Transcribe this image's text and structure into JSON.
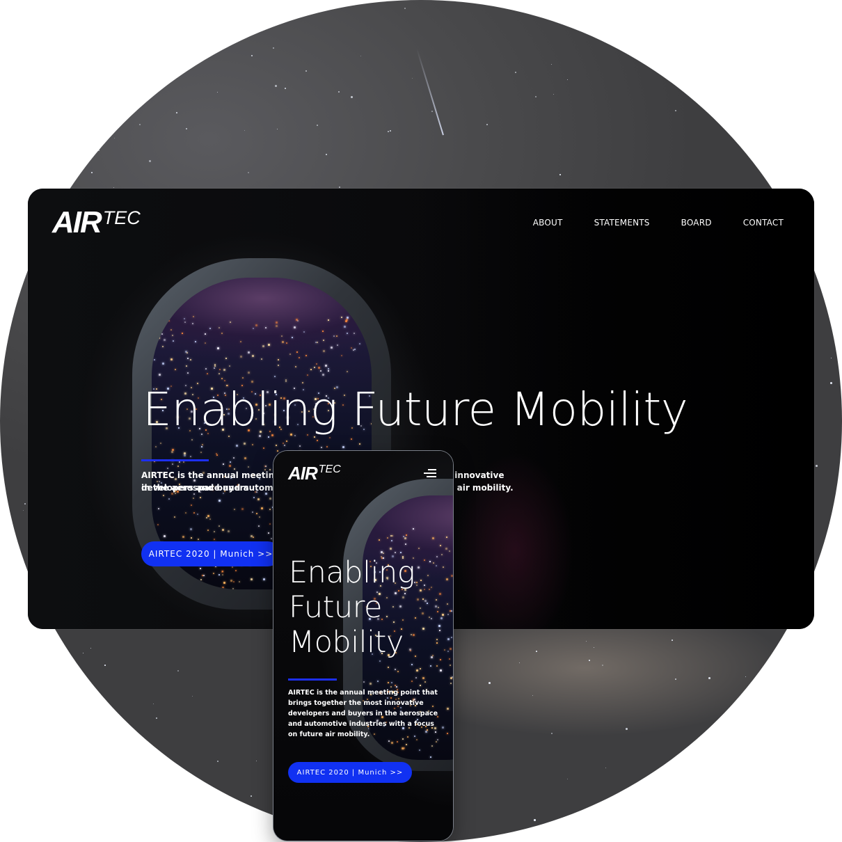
{
  "brand": {
    "logo_main": "AIR",
    "logo_sub": "TEC"
  },
  "nav": {
    "items": [
      "ABOUT",
      "STATEMENTS",
      "BOARD",
      "CONTACT"
    ]
  },
  "hero": {
    "title": "Enabling Future Mobility",
    "title_line1": "Enabling",
    "title_line2": "Future",
    "title_line3": "Mobility",
    "desc_desktop_line1": "AIRTEC is the annual meeting point that brings together the most innovative developers and buyers",
    "desc_desktop_line2": "in the aerospace and automotive industries with a focus on future air mobility.",
    "desc_mobile": "AIRTEC is the annual meeting point that brings together the most innovative developers and buyers in the aerospace and automotive industries with a focus on future air mobility.",
    "cta_label": "AIRTEC 2020 | Munich >>"
  },
  "colors": {
    "accent": "#1131f2",
    "background_page": "#050507",
    "text": "#ffffff"
  },
  "icons": {
    "menu": "hamburger-menu-icon"
  }
}
